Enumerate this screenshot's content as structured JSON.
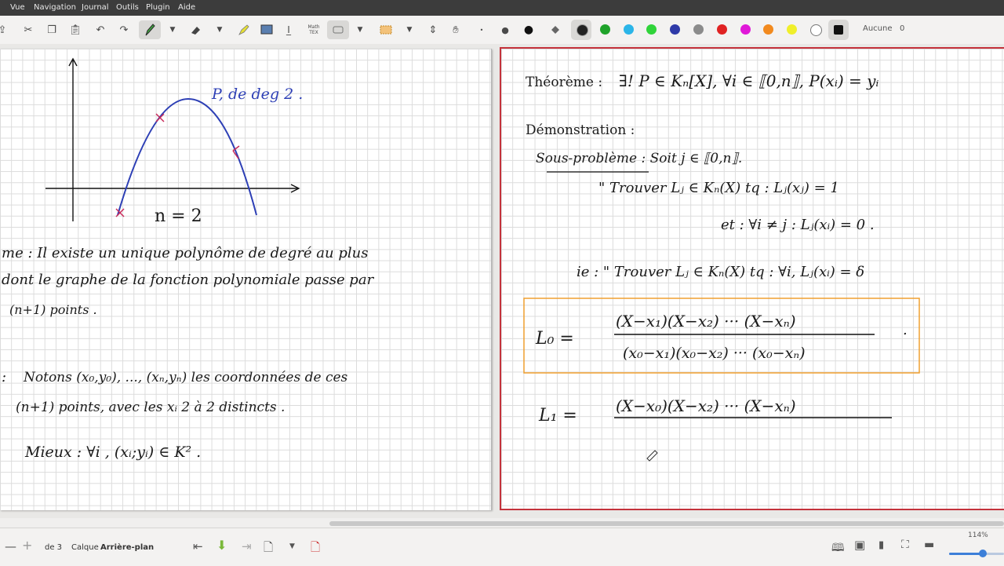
{
  "menu": [
    "Vue",
    "Navigation",
    "Journal",
    "Outils",
    "Plugin",
    "Aide"
  ],
  "toolbar": {
    "math_tex_line1": "Math",
    "math_tex_line2": "TEX",
    "color_hex": [
      "#222222",
      "#1fa32a",
      "#2bb5e8",
      "#30d43a",
      "#2e3aa8",
      "#8b8b8b",
      "#e02222",
      "#e018d8",
      "#f28a1e",
      "#f0ef2a",
      "#ffffff"
    ],
    "selected_color_hex": "#111111",
    "selection_label": "Aucune",
    "selection_count": "0"
  },
  "page_left": {
    "graph": {
      "label_P": "P, de deg 2 .",
      "label_n": "n = 2"
    },
    "theorem_line1": "me :  Il existe un unique polynôme de degré au plus",
    "theorem_line2": "dont le graphe de la fonction polynomiale passe par",
    "theorem_line3": "(n+1) points .",
    "notation_prefix": ":",
    "notation_line1": "Notons (x₀,y₀), ..., (xₙ,yₙ) les coordonnées de ces",
    "notation_line2": "(n+1) points, avec les xᵢ 2 à 2 distincts .",
    "mieux_line": "Mieux : ∀i ,  (xᵢ;yᵢ) ∈ K² ."
  },
  "page_right": {
    "theoreme_label": "Théorème :",
    "theoreme_formula": "∃! P ∈ Kₙ[X], ∀i ∈ ⟦0,n⟧, P(xᵢ) = yᵢ",
    "demonstration_label": "Démonstration :",
    "sous_probleme": "Sous-problème :  Soit j ∈ ⟦0,n⟧.",
    "trouver_line": "\" Trouver  Lⱼ ∈ Kₙ(X) tq :    Lⱼ(xⱼ) = 1",
    "et_line": "et : ∀i ≠ j :        Lⱼ(xᵢ) = 0 .",
    "ie_line": "ie : \" Trouver  Lⱼ ∈ Kₙ(X) tq : ∀i, Lⱼ(xᵢ) = δ",
    "L0_lhs": "L₀  =",
    "L0_num": "(X−x₁)(X−x₂) ··· (X−xₙ)",
    "L0_den": "(x₀−x₁)(x₀−x₂) ··· (x₀−xₙ)",
    "L0_dot": ".",
    "L1_lhs": "L₁  =",
    "L1_num": "(X−x₀)(X−x₂) ··· (X−xₙ)",
    "box_color": "#f0a030",
    "page_border_color": "#c4323b"
  },
  "status": {
    "page_of": "de 3",
    "layer_label": "Calque",
    "layer_value": "Arrière-plan",
    "zoom": "114%",
    "zoom_fraction": 0.62
  }
}
